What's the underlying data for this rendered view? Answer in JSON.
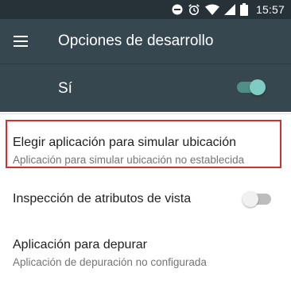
{
  "status_bar": {
    "time": "15:57",
    "icons": [
      "do-not-disturb-icon",
      "alarm-icon",
      "wifi-icon",
      "signal-icon",
      "battery-icon"
    ],
    "background": "#263238"
  },
  "app_bar": {
    "title": "Opciones de desarrollo",
    "menu_icon": "hamburger-menu-icon",
    "background": "#37474f"
  },
  "master_switch": {
    "label": "Sí",
    "state": "on",
    "accent": "#80cbc4"
  },
  "settings": {
    "mock_location": {
      "title": "Elegir aplicación para simular ubicación",
      "subtitle": "Aplicación para simular ubicación no establecida",
      "highlighted": true,
      "highlight_color": "#d32f2f"
    },
    "view_attribute_inspection": {
      "title": "Inspección de atributos de vista",
      "state": "off"
    },
    "debug_app": {
      "title": "Aplicación para depurar",
      "subtitle": "Aplicación de depuración no configurada"
    }
  }
}
